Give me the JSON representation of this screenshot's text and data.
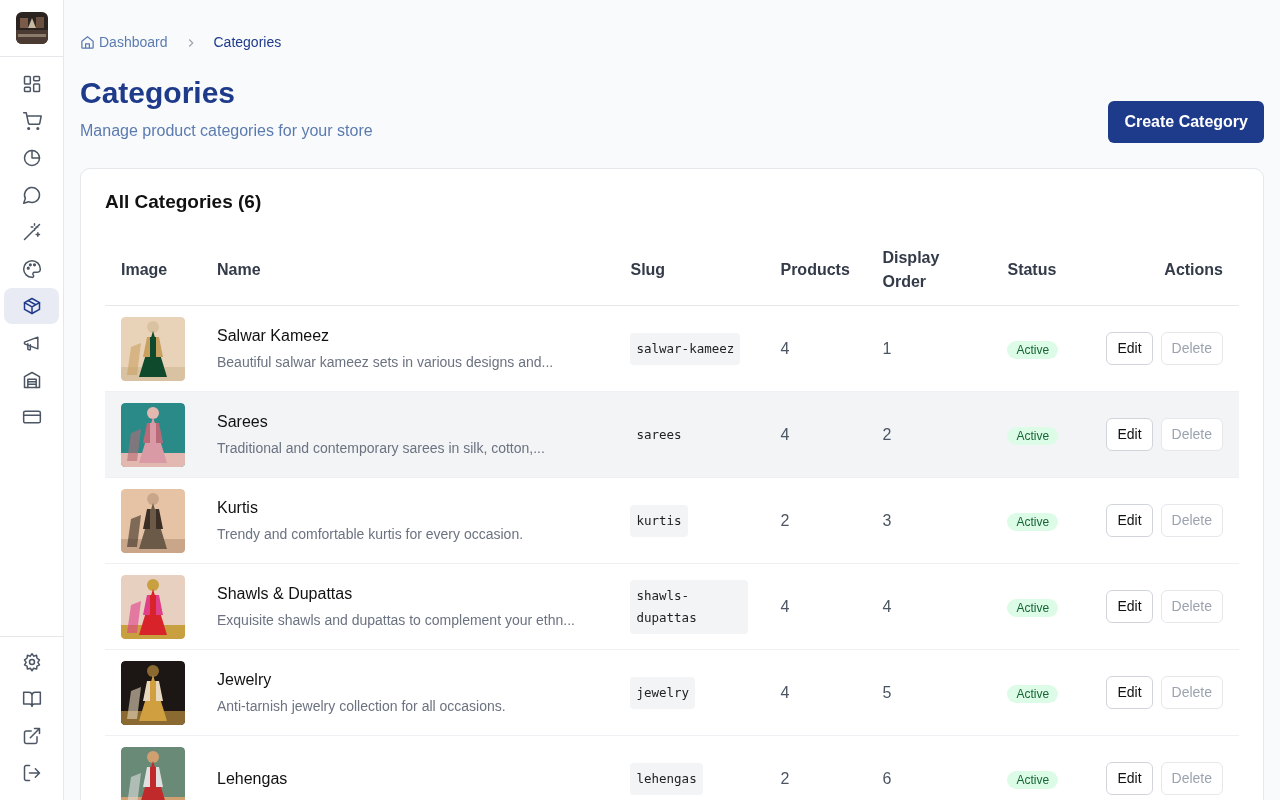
{
  "sidebar": {
    "items": [
      {
        "kind": "grid",
        "selected": false
      },
      {
        "kind": "cart",
        "selected": false
      },
      {
        "kind": "pie",
        "selected": false
      },
      {
        "kind": "chat",
        "selected": false
      },
      {
        "kind": "wand",
        "selected": false
      },
      {
        "kind": "palette",
        "selected": false
      },
      {
        "kind": "box",
        "selected": true
      },
      {
        "kind": "megaphone",
        "selected": false
      },
      {
        "kind": "warehouse",
        "selected": false
      },
      {
        "kind": "card",
        "selected": false
      }
    ],
    "bottom_items": [
      {
        "kind": "gear"
      },
      {
        "kind": "book"
      },
      {
        "kind": "external"
      },
      {
        "kind": "logout"
      }
    ]
  },
  "breadcrumb": [
    {
      "label": "Dashboard",
      "current": false
    },
    {
      "label": "Categories",
      "current": true
    }
  ],
  "page": {
    "title": "Categories",
    "subtitle": "Manage product categories for your store",
    "action": "Create Category"
  },
  "table": {
    "title": "All Categories (6)",
    "columns": [
      "Image",
      "Name",
      "Slug",
      "Products",
      "Display Order",
      "Status",
      "Actions"
    ],
    "rows": [
      {
        "name": "Salwar Kameez",
        "description": "Beautiful salwar kameez sets in various designs and...",
        "slug": "salwar-kameez",
        "products": "4",
        "order": "1",
        "status": "Active",
        "highlighted": false,
        "actions": [
          "Edit",
          "Delete"
        ]
      },
      {
        "name": "Sarees",
        "description": "Traditional and contemporary sarees in silk, cotton,...",
        "slug": "sarees",
        "products": "4",
        "order": "2",
        "status": "Active",
        "highlighted": true,
        "actions": [
          "Edit",
          "Delete"
        ]
      },
      {
        "name": "Kurtis",
        "description": "Trendy and comfortable kurtis for every occasion.",
        "slug": "kurtis",
        "products": "2",
        "order": "3",
        "status": "Active",
        "highlighted": false,
        "actions": [
          "Edit",
          "Delete"
        ]
      },
      {
        "name": "Shawls & Dupattas",
        "description": "Exquisite shawls and dupattas to complement your ethn...",
        "slug": "shawls-dupattas",
        "products": "4",
        "order": "4",
        "status": "Active",
        "highlighted": false,
        "actions": [
          "Edit",
          "Delete"
        ]
      },
      {
        "name": "Jewelry",
        "description": "Anti-tarnish jewelry collection for all occasions.",
        "slug": "jewelry",
        "products": "4",
        "order": "5",
        "status": "Active",
        "highlighted": false,
        "actions": [
          "Edit",
          "Delete"
        ]
      },
      {
        "name": "Lehengas",
        "slug": "lehengas",
        "products": "2",
        "order": "6",
        "status": "Active",
        "highlighted": false,
        "actions": [
          "Edit",
          "Delete"
        ]
      }
    ]
  }
}
